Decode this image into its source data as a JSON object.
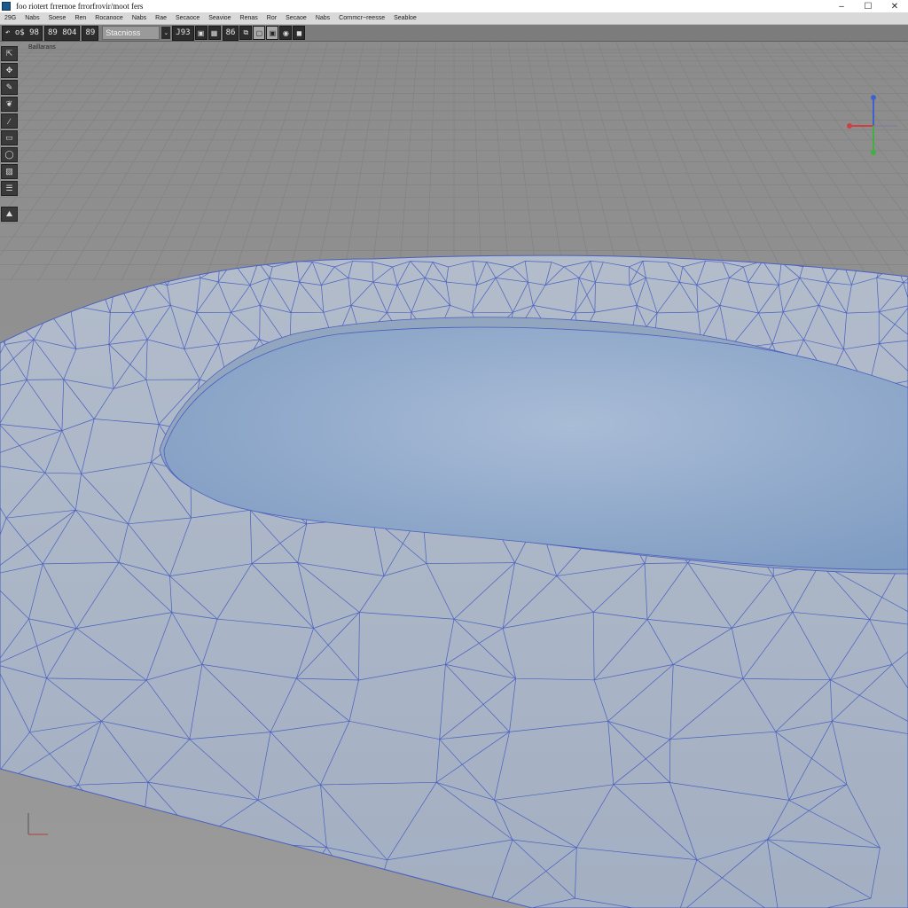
{
  "window": {
    "title": "foo riotert frrernoe frrorfrovir/moot fers",
    "controls": {
      "minimize": "–",
      "maximize": "☐",
      "close": "✕"
    }
  },
  "menu": [
    "29G",
    "Nabs",
    "Soese",
    "Ren",
    "Rocanoce",
    "Nabs",
    "Rae",
    "Secaoce",
    "Seavioe",
    "Renas",
    "Ror",
    "Secaoe",
    "Nabs",
    "Cornmcr~reesse",
    "Seabloe"
  ],
  "toolbar": {
    "group1_text": "o$ 98",
    "group2_text": "89 8O4",
    "group3_text": "89",
    "select_value": "Stacnioss",
    "group4_text": "J93",
    "group5_text": "86",
    "dropdown_glyph": "⌄"
  },
  "viewport": {
    "label": "Baillarans",
    "colors": {
      "background_top": "#8c8c8c",
      "background_bottom": "#9a9a9a",
      "grid_line": "#808080",
      "mesh_fill": "#aab6c8",
      "mesh_edge": "#4a5fc0",
      "water_center": "#9bb2cf",
      "water_edge": "#7f9cc2"
    }
  },
  "shelf_icons": [
    "select-icon",
    "move-icon",
    "paint-icon",
    "sculpt-icon",
    "brush-icon",
    "box-icon",
    "sphere-icon",
    "image-icon",
    "layers-icon",
    "terrain-icon"
  ],
  "gizmo": {
    "x_color": "#d04040",
    "y_color": "#40b040",
    "z_color": "#4060d0"
  }
}
